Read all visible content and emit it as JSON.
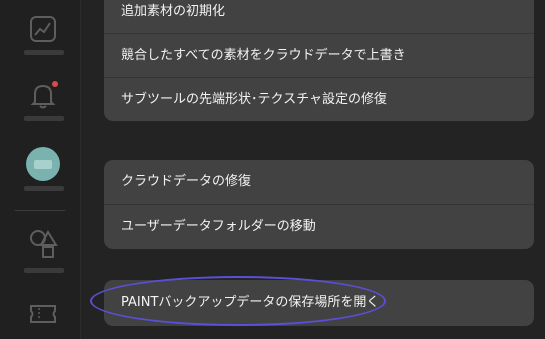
{
  "sidebar": {
    "items": [
      {
        "icon": "chart-icon"
      },
      {
        "icon": "bell-icon",
        "has_notification": true
      },
      {
        "icon": "avatar"
      },
      {
        "icon": "shapes-icon"
      },
      {
        "icon": "ticket-icon"
      }
    ]
  },
  "settings": {
    "group1": {
      "items": [
        {
          "label": "追加素材の初期化"
        },
        {
          "label": "競合したすべての素材をクラウドデータで上書き"
        },
        {
          "label": "サブツールの先端形状･テクスチャ設定の修復"
        }
      ]
    },
    "group2": {
      "items": [
        {
          "label": "クラウドデータの修復"
        },
        {
          "label": "ユーザーデータフォルダーの移動"
        }
      ]
    },
    "group3": {
      "items": [
        {
          "label": "PAINTバックアップデータの保存場所を開く"
        }
      ]
    }
  },
  "colors": {
    "background": "#232323",
    "card": "#424242",
    "highlight": "#5a4fd6",
    "notification": "#d94a4a",
    "avatar": "#79b2ae"
  }
}
